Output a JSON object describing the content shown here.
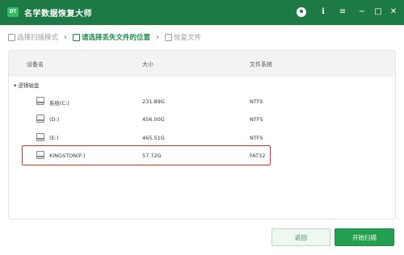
{
  "titlebar": {
    "logo": "DT",
    "title": "名学数据恢复大师",
    "icons": [
      "user-avatar-icon",
      "help-icon",
      "menu-icon",
      "minimize-icon",
      "maximize-icon",
      "close-icon"
    ],
    "glyphs": {
      "help": "ℹ",
      "menu": "≡",
      "minimize": "−",
      "maximize": "□",
      "close": "✕"
    }
  },
  "steps": [
    {
      "label": "选择扫描模式",
      "state": "done"
    },
    {
      "label": "请选择丢失文件的位置",
      "state": "active"
    },
    {
      "label": "恢复文件",
      "state": "todo"
    }
  ],
  "arrow": "›",
  "table": {
    "columns": [
      "设备名",
      "大小",
      "文件系统"
    ],
    "group_label": "逻辑磁盘",
    "group_toggle": "▾",
    "rows": [
      {
        "name": "系统(C:)",
        "size": "231.89G",
        "fs": "NTFS"
      },
      {
        "name": "(D:)",
        "size": "456.00G",
        "fs": "NTFS"
      },
      {
        "name": "(E:)",
        "size": "465.51G",
        "fs": "NTFS"
      },
      {
        "name": "KINGSTON(F:)",
        "size": "57.72G",
        "fs": "FAT32"
      }
    ]
  },
  "buttons": {
    "back": "返回",
    "start": "开始扫描"
  },
  "colors": {
    "brand_green": "#1e7a44",
    "button_green": "#22a050",
    "highlight_red": "#e03030"
  }
}
